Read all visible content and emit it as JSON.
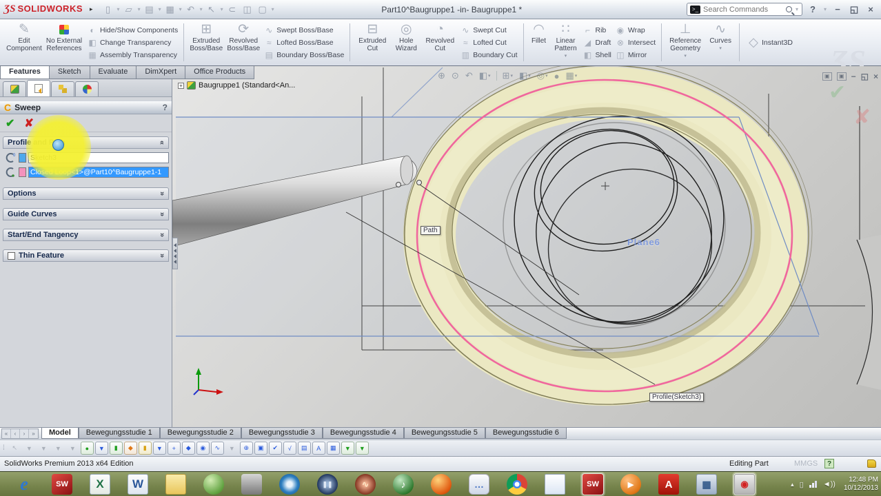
{
  "titlebar": {
    "logo_mark": "ƷS",
    "logo_text": "SOLIDWORKS",
    "title": "Part10^Baugruppe1 -in- Baugruppe1 *",
    "search_placeholder": "Search Commands"
  },
  "ribbon": {
    "edit_component": "Edit Component",
    "no_external_references": "No External References",
    "hide_show_components": "Hide/Show Components",
    "change_transparency": "Change Transparency",
    "assembly_transparency": "Assembly Transparency",
    "extruded_boss": "Extruded Boss/Base",
    "revolved_boss": "Revolved Boss/Base",
    "swept_boss": "Swept Boss/Base",
    "lofted_boss": "Lofted Boss/Base",
    "boundary_boss": "Boundary Boss/Base",
    "extruded_cut": "Extruded Cut",
    "hole_wizard": "Hole Wizard",
    "revolved_cut": "Revolved Cut",
    "swept_cut": "Swept Cut",
    "lofted_cut": "Lofted Cut",
    "boundary_cut": "Boundary Cut",
    "fillet": "Fillet",
    "linear_pattern": "Linear Pattern",
    "rib": "Rib",
    "draft": "Draft",
    "shell": "Shell",
    "wrap": "Wrap",
    "intersect": "Intersect",
    "mirror": "Mirror",
    "reference_geometry": "Reference Geometry",
    "curves": "Curves",
    "instant3d": "Instant3D",
    "watermark": "ƷS"
  },
  "command_tabs": {
    "items": [
      {
        "label": "Features",
        "cls": "active",
        "name": "tab-features"
      },
      {
        "label": "Sketch",
        "name": "tab-sketch"
      },
      {
        "label": "Evaluate",
        "name": "tab-evaluate"
      },
      {
        "label": "DimXpert",
        "name": "tab-dimxpert"
      },
      {
        "label": "Office Products",
        "name": "tab-office-products"
      }
    ]
  },
  "panel": {
    "title": "Sweep",
    "help": "?",
    "profile_and_path": "Profile and Path",
    "profile_value": "Sketch3",
    "path_value": "Closed Loop<1>@Part10^Baugruppe1-1",
    "options": "Options",
    "guide_curves": "Guide Curves",
    "start_end_tangency": "Start/End Tangency",
    "thin_feature": "Thin Feature"
  },
  "viewport": {
    "tree_item": "Baugruppe1  (Standard<An...",
    "path_tooltip": "Path",
    "profile_tooltip": "Profile(Sketch3)",
    "plane_label": "Plane6"
  },
  "bottom_tabs": {
    "items": [
      {
        "label": "Model",
        "cls": "active",
        "name": "tab-model"
      },
      {
        "label": "Bewegungsstudie 1",
        "name": "tab-bewegungsstudie-1"
      },
      {
        "label": "Bewegungsstudie 2",
        "name": "tab-bewegungsstudie-2"
      },
      {
        "label": "Bewegungsstudie 3",
        "name": "tab-bewegungsstudie-3"
      },
      {
        "label": "Bewegungsstudie 4",
        "name": "tab-bewegungsstudie-4"
      },
      {
        "label": "Bewegungsstudie 5",
        "name": "tab-bewegungsstudie-5"
      },
      {
        "label": "Bewegungsstudie 6",
        "name": "tab-bewegungsstudie-6"
      }
    ]
  },
  "motionbar": {
    "icons": [
      {
        "name": "select-icon",
        "cls": "mdis",
        "glyph": "↖"
      },
      {
        "name": "filter-animation-icon",
        "cls": "mdis",
        "glyph": "▼"
      },
      {
        "name": "filter-driving-icon",
        "cls": "mdis",
        "glyph": "▼"
      },
      {
        "name": "filter-selected-icon",
        "cls": "mdis",
        "glyph": "▼"
      },
      {
        "name": "filter-results-icon",
        "cls": "mdis",
        "glyph": "▼"
      },
      {
        "name": "calculate-icon",
        "cls": "mgreen",
        "glyph": "●"
      },
      {
        "name": "play-from-start-icon",
        "cls": "mblue",
        "glyph": "▼"
      },
      {
        "name": "play-icon",
        "cls": "mgreen",
        "glyph": "▮"
      },
      {
        "name": "stop-icon",
        "cls": "morange",
        "glyph": "◆"
      },
      {
        "name": "save-animation-icon",
        "cls": "myellow",
        "glyph": "▮"
      },
      {
        "name": "animation-wizard-icon",
        "cls": "mblue",
        "glyph": "▼"
      },
      {
        "name": "auto-key-icon",
        "cls": "mblue",
        "glyph": "+"
      },
      {
        "name": "add-key-icon",
        "cls": "mblue",
        "glyph": "◆"
      },
      {
        "name": "motor-icon",
        "cls": "mblue",
        "glyph": "◉"
      },
      {
        "name": "spring-icon",
        "cls": "mblue",
        "glyph": "∿"
      },
      {
        "name": "filter-funnel-icon",
        "cls": "mdis",
        "glyph": "▼"
      },
      {
        "name": "gravity-icon",
        "cls": "mblue",
        "glyph": "⊕"
      },
      {
        "name": "contact-icon",
        "cls": "mblue",
        "glyph": "▣"
      },
      {
        "name": "results-icon",
        "cls": "mblue",
        "glyph": "✔"
      },
      {
        "name": "plot-icon",
        "cls": "mblue",
        "glyph": "√"
      },
      {
        "name": "chart-icon",
        "cls": "mblue",
        "glyph": "▤"
      },
      {
        "name": "annotation-icon",
        "cls": "mblue",
        "glyph": "A"
      },
      {
        "name": "study-properties-icon",
        "cls": "mblue",
        "glyph": "▦"
      },
      {
        "name": "collapse-icon",
        "cls": "mgreen",
        "glyph": "▼"
      },
      {
        "name": "expand-icon",
        "cls": "mgreen",
        "glyph": "▼"
      }
    ]
  },
  "statusbar": {
    "product": "SolidWorks Premium 2013 x64 Edition",
    "mode": "Editing Part",
    "units": "MMGS"
  },
  "taskbar": {
    "icons": [
      {
        "name": "internet-explorer-icon",
        "cls": "ic-ie",
        "glyph": "e"
      },
      {
        "name": "solidworks-icon",
        "cls": "ic-sw",
        "glyph": "SW"
      },
      {
        "name": "excel-icon",
        "cls": "ic-xl",
        "glyph": "X"
      },
      {
        "name": "word-icon",
        "cls": "ic-wd",
        "glyph": "W"
      },
      {
        "name": "file-explorer-icon",
        "cls": "ic-folder",
        "glyph": ""
      },
      {
        "name": "green-app-icon",
        "cls": "ic-green",
        "glyph": ""
      },
      {
        "name": "camera-app-icon",
        "cls": "ic-cam",
        "glyph": ""
      },
      {
        "name": "dvd-player-icon",
        "cls": "ic-dvd",
        "glyph": ""
      },
      {
        "name": "movie-app-icon",
        "cls": "ic-film",
        "glyph": "❚❚"
      },
      {
        "name": "audio-app-icon",
        "cls": "ic-aud",
        "glyph": "∿"
      },
      {
        "name": "itunes-icon",
        "cls": "ic-itunes",
        "glyph": "♪"
      },
      {
        "name": "firefox-icon",
        "cls": "ic-ff",
        "glyph": ""
      },
      {
        "name": "messenger-icon",
        "cls": "ic-msg",
        "glyph": "…"
      },
      {
        "name": "chrome-icon",
        "cls": "ic-chrome",
        "glyph": ""
      },
      {
        "name": "notepad-icon",
        "cls": "ic-note",
        "glyph": ""
      },
      {
        "name": "solidworks-active-icon",
        "cls": "ic-sw active-task",
        "glyph": "SW"
      },
      {
        "name": "media-player-icon",
        "cls": "ic-wmp",
        "glyph": "▶"
      },
      {
        "name": "adobe-reader-icon",
        "cls": "ic-pdf",
        "glyph": "A"
      },
      {
        "name": "calculator-icon",
        "cls": "ic-calc",
        "glyph": "▦"
      },
      {
        "name": "photo-viewer-icon",
        "cls": "ic-photo active-task",
        "glyph": "◉"
      }
    ],
    "tray_time": "12:48 PM",
    "tray_date": "10/12/2013"
  },
  "icon_glyphs": {
    "new-document": "▯",
    "open": "▱",
    "save": "▤",
    "print": "▦",
    "undo": "↶",
    "select-pointer": "↖",
    "attachment": "⊂",
    "properties": "◫",
    "window-options": "▢",
    "caret": "▾",
    "menu-arrow": "▸",
    "edit-component": "✎",
    "hide-show-components": "◐",
    "change-transparency": "◧",
    "assembly-transparency": "▦",
    "extruded-boss": "⊞",
    "revolved-boss": "⟳",
    "swept-boss": "∿",
    "lofted-boss": "≈",
    "boundary-boss": "▤",
    "extruded-cut": "⊟",
    "hole-wizard": "◎",
    "revolved-cut": "◔",
    "swept-cut": "∿",
    "lofted-cut": "≈",
    "boundary-cut": "▥",
    "fillet": "◠",
    "linear-pattern": "∷",
    "rib": "⌐",
    "draft": "◢",
    "shell": "◧",
    "wrap": "◉",
    "intersect": "⊗",
    "mirror": "◫",
    "reference-geometry": "⊥",
    "curves": "∿",
    "instant3d": "◇",
    "zoom-fit": "⊕",
    "zoom-area": "⊙",
    "previous-view": "↶",
    "section-view": "◧",
    "view-orientation": "⊞",
    "display-style": "◧",
    "hide-show-items": "◎",
    "appearance": "●",
    "scene": "▦",
    "minimize": "−",
    "restore": "◱",
    "close": "×",
    "help": "?",
    "chevron": "»",
    "expand-plus": "+",
    "console-prompt": ">_",
    "nav-first": "«",
    "nav-prev": "‹",
    "nav-next": "›",
    "nav-last": "»",
    "ok-check": "✔",
    "cancel-x": "✘",
    "handle-dots": "⁞"
  }
}
